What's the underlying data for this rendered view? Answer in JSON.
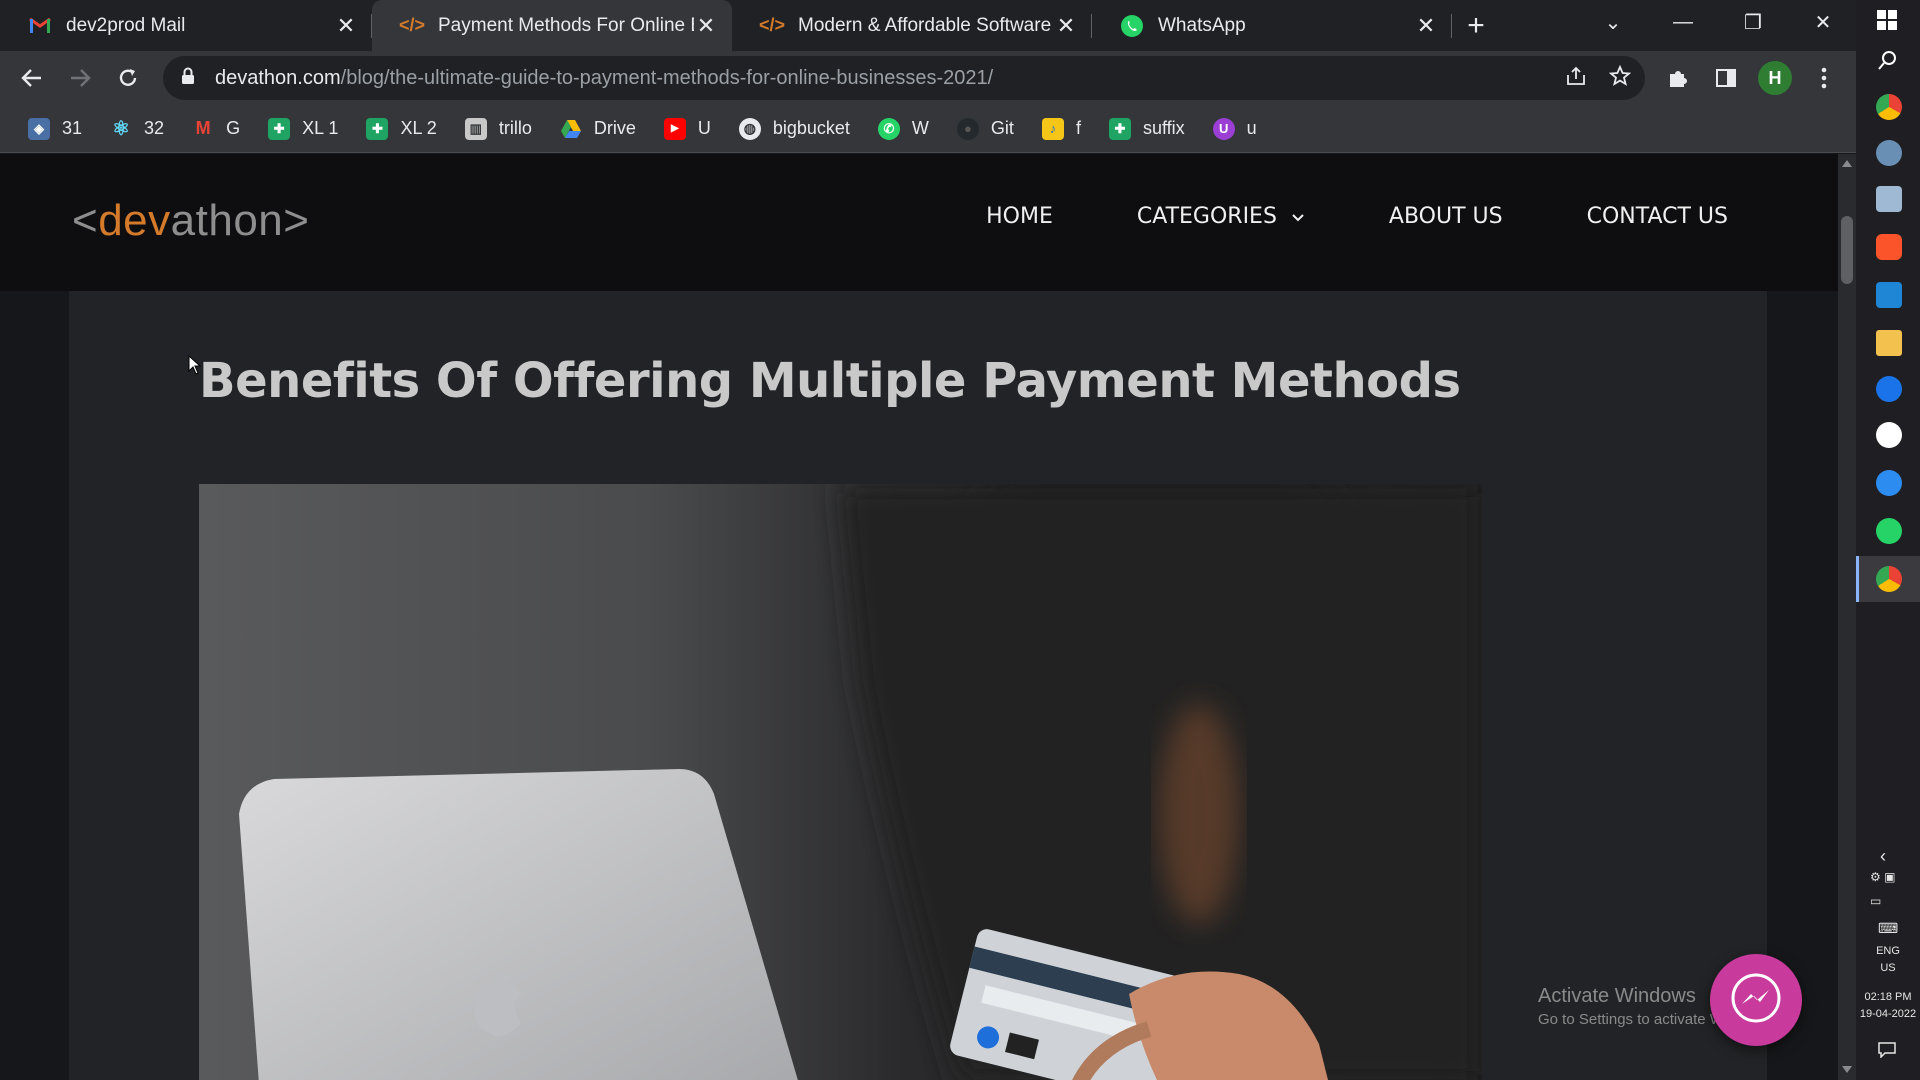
{
  "tabs": [
    {
      "title": "dev2prod Mail",
      "icon": "gmail-icon"
    },
    {
      "title": "Payment Methods For Online Bus",
      "icon": "devathon-code-icon",
      "active": true
    },
    {
      "title": "Modern & Affordable Software D",
      "icon": "devathon-code-icon"
    },
    {
      "title": "WhatsApp",
      "icon": "whatsapp-icon"
    }
  ],
  "address": {
    "host": "devathon.com",
    "path": "/blog/the-ultimate-guide-to-payment-methods-for-online-businesses-2021/"
  },
  "profile_initial": "H",
  "bookmarks": [
    {
      "label": "31",
      "icon": "app-icon"
    },
    {
      "label": "32",
      "icon": "react-icon"
    },
    {
      "label": "G",
      "icon": "gmail-icon"
    },
    {
      "label": "XL 1",
      "icon": "sheets-icon"
    },
    {
      "label": "XL 2",
      "icon": "sheets-icon"
    },
    {
      "label": "trillo",
      "icon": "trello-icon"
    },
    {
      "label": "Drive",
      "icon": "drive-icon"
    },
    {
      "label": "U",
      "icon": "youtube-icon"
    },
    {
      "label": "bigbucket",
      "icon": "globe-icon"
    },
    {
      "label": "W",
      "icon": "whatsapp-icon"
    },
    {
      "label": "Git",
      "icon": "github-icon"
    },
    {
      "label": "f",
      "icon": "folder-icon"
    },
    {
      "label": "suffix",
      "icon": "sheets-icon"
    },
    {
      "label": "u",
      "icon": "u-icon"
    }
  ],
  "site": {
    "logo_lt": "<",
    "logo_dev": "dev",
    "logo_athon": "athon",
    "logo_gt": ">",
    "nav": {
      "home": "HOME",
      "categories": "CATEGORIES",
      "about": "ABOUT US",
      "contact": "CONTACT US"
    }
  },
  "article": {
    "heading": "Benefits Of Offering Multiple Payment Methods"
  },
  "watermark": {
    "line1": "Activate Windows",
    "line2": "Go to Settings to activate Windows."
  },
  "taskbar": {
    "lang1": "ENG",
    "lang2": "US",
    "time": "02:18 PM",
    "date": "19-04-2022"
  },
  "colors": {
    "accent": "#d47a2b",
    "page_bg": "#16171a",
    "header_bg": "#0e0e10",
    "chat_bubble": "#c83a9b"
  }
}
